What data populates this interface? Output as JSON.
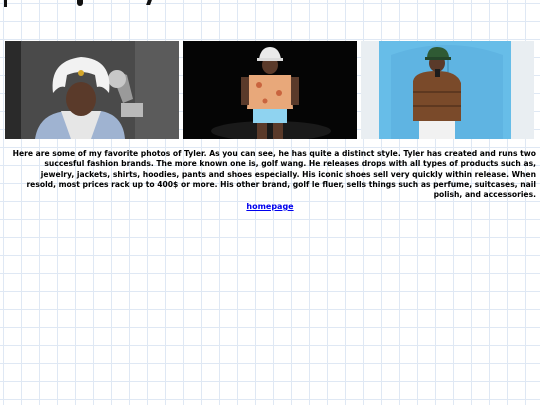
{
  "photos": [
    {
      "subject": "Tyler wearing a white fur trapper hat and a blue patterned coat next to a gramophone trophy"
    },
    {
      "subject": "Tyler performing on stage in a white hat, floral shirt and light blue shorts"
    },
    {
      "subject": "Tyler in a green hat and brown puffer jacket holding a phone in front of a blue door"
    }
  ],
  "caption": "Here are some of my favorite photos of Tyler. As you can see, he has quite a distinct style. Tyler has created and runs two succesful fashion brands. The more known one is, golf wang. He releases drops with all types of products such as, jewelry, jackets, shirts, hoodies, pants and shoes especially. His iconic shoes sell very quickly within release. When resold, most prices rack up to 400$ or more. His other brand, golf le fluer, sells things such as perfume, suitcases, nail polish, and accessories.",
  "link": {
    "label": "homepage"
  },
  "colors": {
    "grid_line": "#dfe8f4",
    "link": "#0000ee",
    "text": "#000000"
  }
}
